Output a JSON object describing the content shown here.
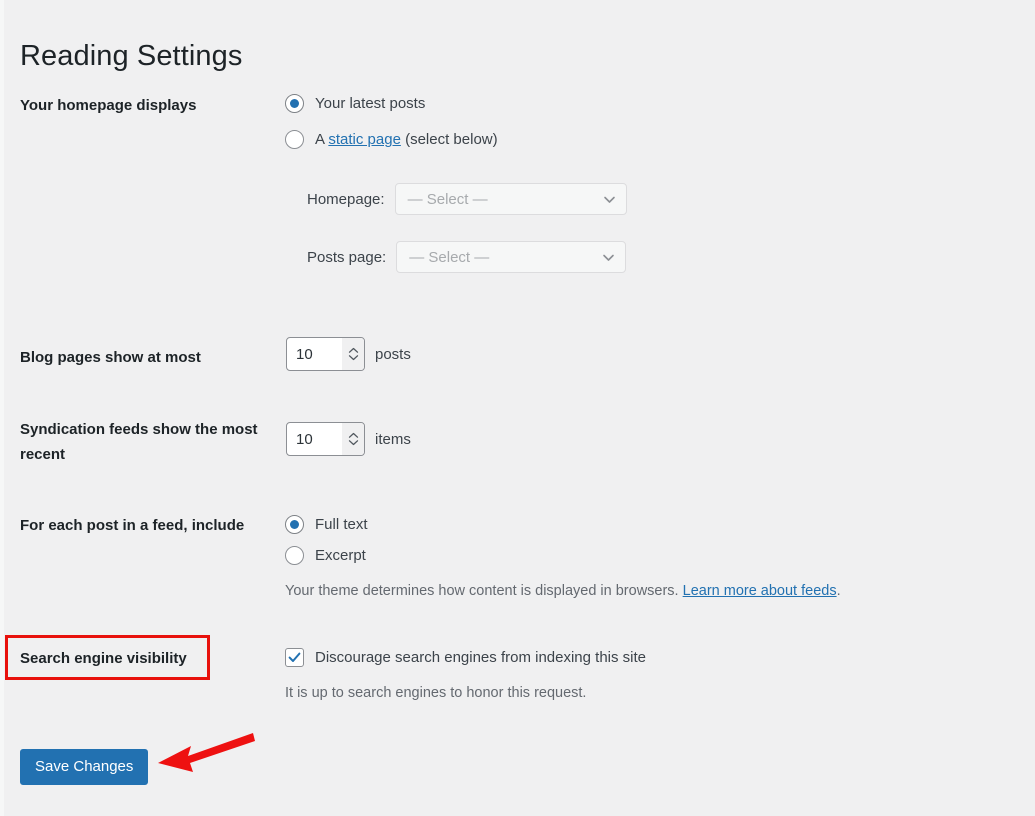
{
  "page": {
    "title": "Reading Settings"
  },
  "rows": {
    "homepage_displays": {
      "label": "Your homepage displays",
      "options": [
        {
          "label": "Your latest posts",
          "checked": true
        },
        {
          "label_before": "A ",
          "link": "static page",
          "label_after": " (select below)",
          "checked": false
        }
      ],
      "selects": [
        {
          "label": "Homepage:",
          "value": "— Select —",
          "placeholder": "— Select —"
        },
        {
          "label": "Posts page:",
          "value": "— Select —",
          "placeholder": "— Select —"
        }
      ]
    },
    "blog_pages": {
      "label": "Blog pages show at most",
      "value": "10",
      "unit": "posts"
    },
    "syndication_feeds": {
      "label": "Syndication feeds show the most recent",
      "value": "10",
      "unit": "items"
    },
    "feed_include": {
      "label": "For each post in a feed, include",
      "options": [
        {
          "label": "Full text",
          "checked": true
        },
        {
          "label": "Excerpt",
          "checked": false
        }
      ],
      "help_before": "Your theme determines how content is displayed in browsers. ",
      "help_link": "Learn more about feeds",
      "help_after": "."
    },
    "search_visibility": {
      "label": "Search engine visibility",
      "checkbox_label": "Discourage search engines from indexing this site",
      "checkbox_checked": true,
      "help": "It is up to search engines to honor this request."
    }
  },
  "submit": {
    "label": "Save Changes"
  },
  "colors": {
    "accent": "#2271b1",
    "link": "#2271b1",
    "annotation": "#e8110c",
    "background": "#f0f0f1",
    "heading": "#1d2327"
  },
  "icons": {
    "chevron_down": "chevron-down-icon",
    "spinner_up": "spinner-up-icon",
    "spinner_down": "spinner-down-icon",
    "checkmark": "checkmark-icon",
    "arrow": "red-arrow-annotation-icon"
  }
}
